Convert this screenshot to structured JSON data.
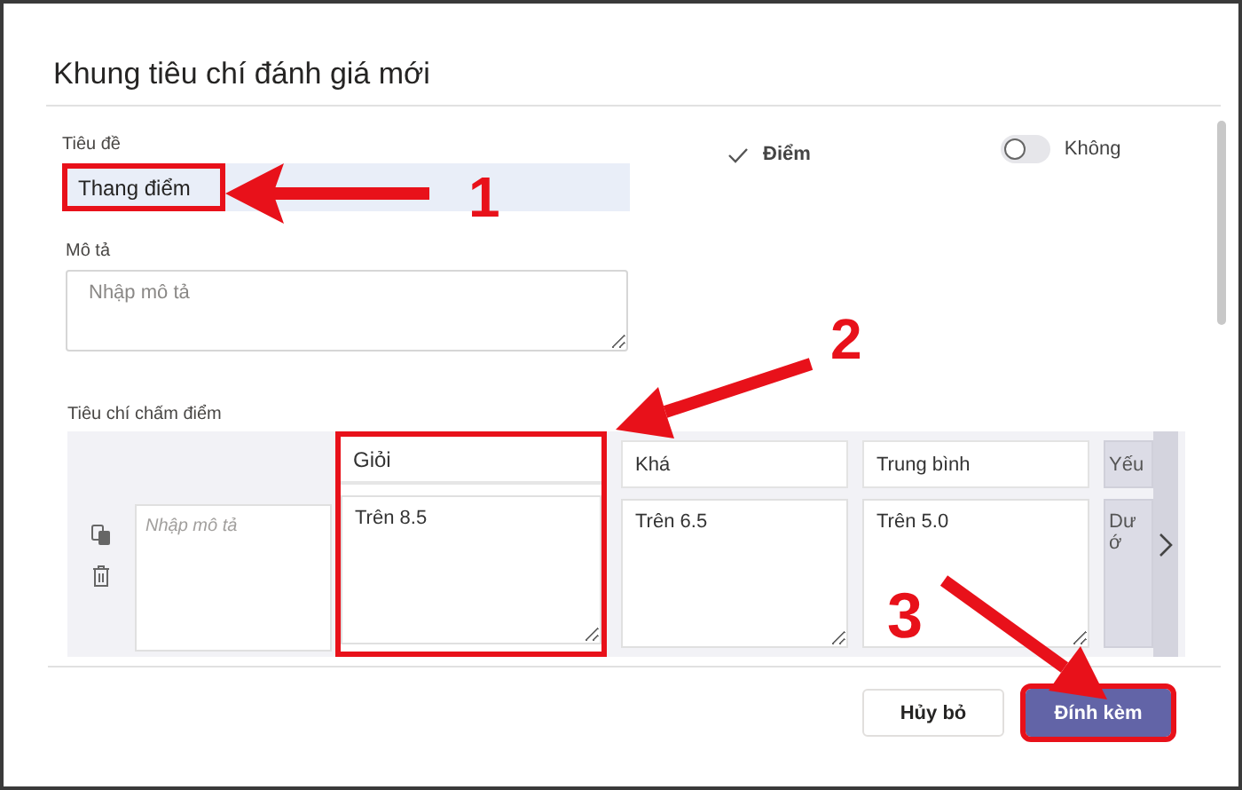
{
  "dialog": {
    "title": "Khung tiêu chí đánh giá mới"
  },
  "title_field": {
    "label": "Tiêu đề",
    "value": "Thang điểm",
    "highlighted": true
  },
  "points": {
    "label": "Điểm",
    "checked": true
  },
  "toggle": {
    "label": "Không",
    "on": false
  },
  "description": {
    "label": "Mô tả",
    "placeholder": "Nhập mô tả"
  },
  "criteria": {
    "label": "Tiêu chí chấm điểm",
    "row_placeholder": "Nhập mô tả",
    "levels": [
      {
        "name": "Giỏi",
        "description": "Trên 8.5",
        "highlighted": true
      },
      {
        "name": "Khá",
        "description": "Trên 6.5",
        "highlighted": false
      },
      {
        "name": "Trung bình",
        "description": "Trên 5.0",
        "highlighted": false
      },
      {
        "name": "Yếu",
        "description": "Dướ",
        "highlighted": false
      }
    ]
  },
  "buttons": [
    {
      "label": "Hủy bỏ",
      "kind": "secondary",
      "highlighted": false
    },
    {
      "label": "Đính kèm",
      "kind": "primary",
      "highlighted": true
    }
  ],
  "annotations": [
    {
      "label": "1"
    },
    {
      "label": "2"
    },
    {
      "label": "3"
    }
  ]
}
